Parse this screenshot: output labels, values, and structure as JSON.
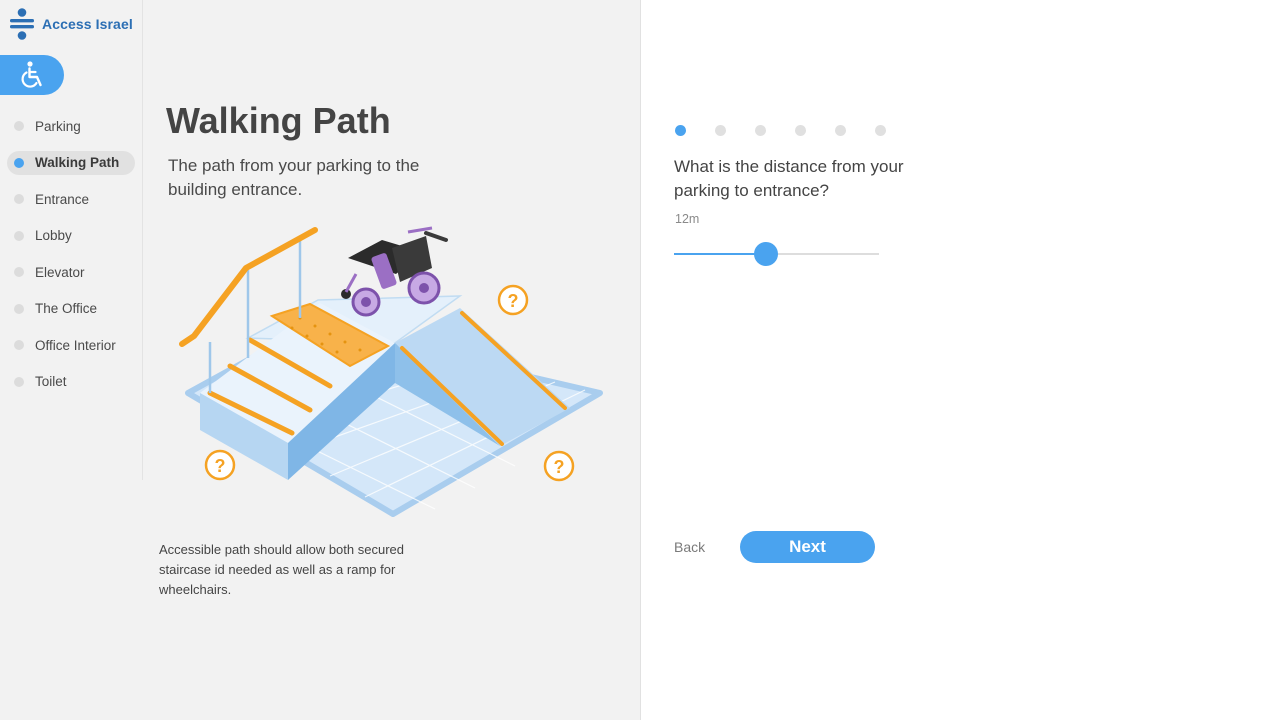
{
  "brand": {
    "name": "Access Israel",
    "color": "#2c6fb4"
  },
  "accessibility_button": {
    "icon": "wheelchair-icon"
  },
  "sidebar": {
    "items": [
      {
        "label": "Parking",
        "active": false
      },
      {
        "label": "Walking Path",
        "active": true
      },
      {
        "label": "Entrance",
        "active": false
      },
      {
        "label": "Lobby",
        "active": false
      },
      {
        "label": "Elevator",
        "active": false
      },
      {
        "label": "The Office",
        "active": false
      },
      {
        "label": "Office Interior",
        "active": false
      },
      {
        "label": "Toilet",
        "active": false
      }
    ]
  },
  "main": {
    "title": "Walking Path",
    "subtitle": "The path from your parking to the building entrance.",
    "note": "Accessible path should allow both secured staircase id needed as well as a ramp for wheelchairs.",
    "illustration": {
      "icons": [
        "stairs-icon",
        "ramp-icon",
        "wheelchair-icon",
        "question-icon"
      ]
    }
  },
  "wizard": {
    "steps_total": 6,
    "current_step": 1,
    "question": "What is the distance from your parking to entrance?",
    "value_label": "12m",
    "slider_fraction": 0.45,
    "back_label": "Back",
    "next_label": "Next"
  },
  "colors": {
    "accent": "#4aa3ef",
    "orange": "#f5a223",
    "purple": "#9b6fc4"
  }
}
